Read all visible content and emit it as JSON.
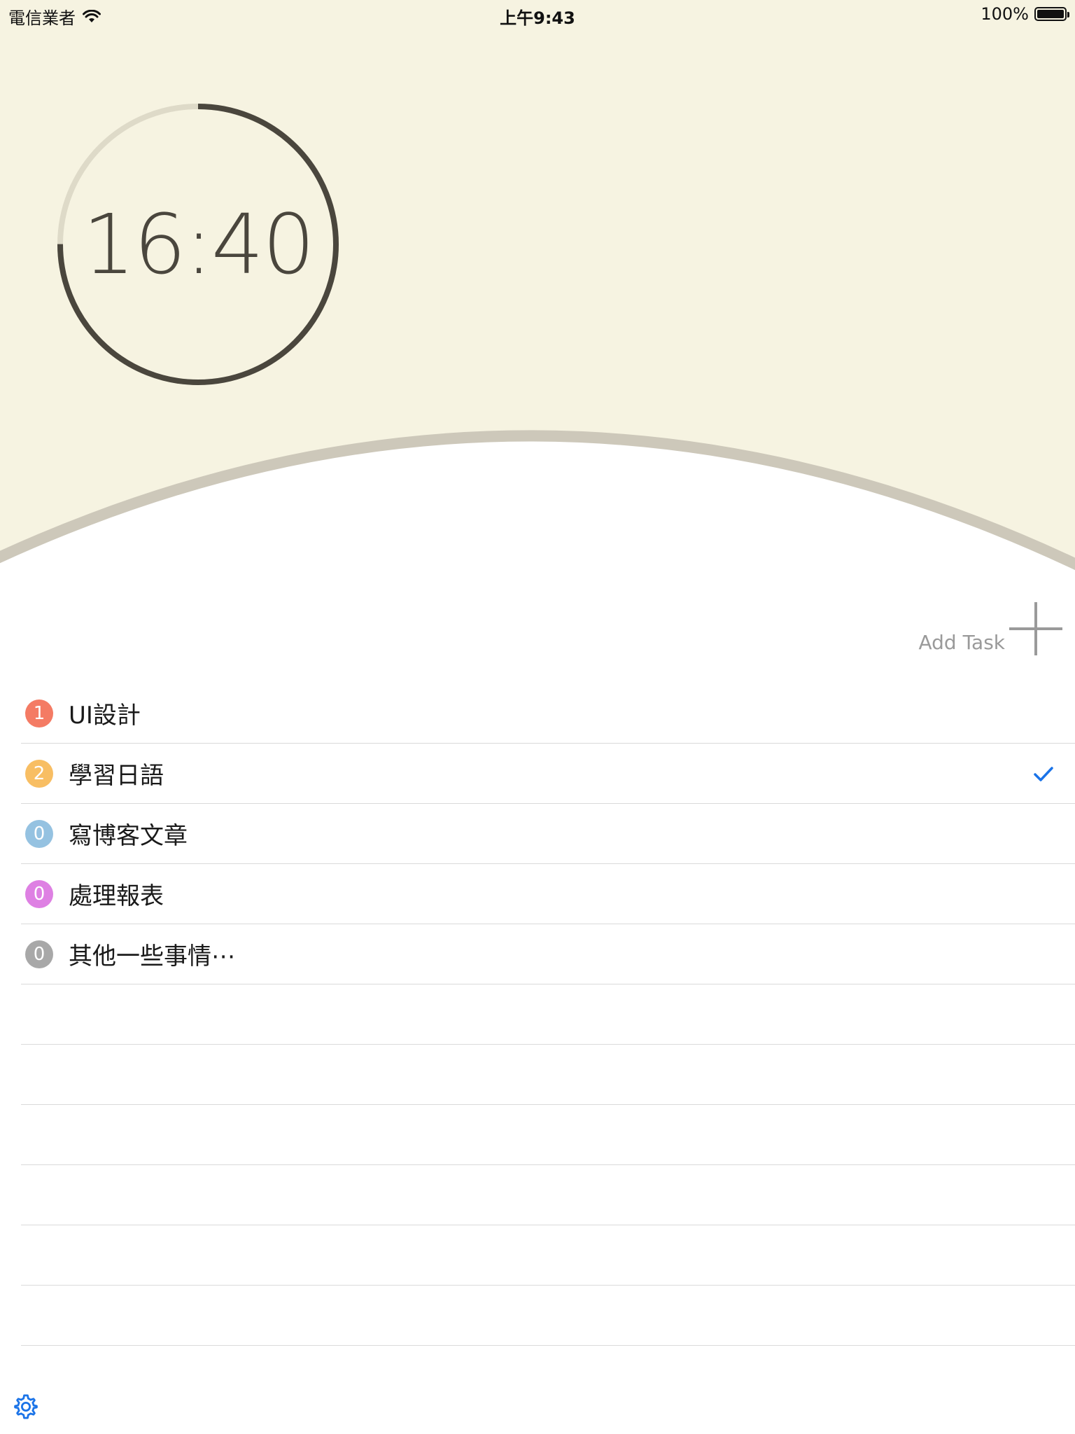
{
  "status_bar": {
    "carrier": "電信業者",
    "time": "上午9:43",
    "battery_label": "100%"
  },
  "timer": {
    "display": "16:40",
    "progress": 0.75
  },
  "add_task": {
    "label": "Add Task",
    "icon": "plus-icon"
  },
  "tasks": [
    {
      "count": "1",
      "name": "UI設計",
      "color": "#F47B64",
      "checked": false
    },
    {
      "count": "2",
      "name": "學習日語",
      "color": "#F8BE63",
      "checked": true
    },
    {
      "count": "0",
      "name": "寫博客文章",
      "color": "#95C2E1",
      "checked": false
    },
    {
      "count": "0",
      "name": "處理報表",
      "color": "#DE80E3",
      "checked": false
    },
    {
      "count": "0",
      "name": "其他一些事情⋯",
      "color": "#A8A8A8",
      "checked": false
    }
  ],
  "settings": {
    "icon": "gear-icon"
  },
  "colors": {
    "background_top": "#F6F3E1",
    "ring_track": "#DEDAC8",
    "ring_progress": "#4A463D",
    "arc": "#CDC8BA",
    "accent": "#1A73E8"
  }
}
